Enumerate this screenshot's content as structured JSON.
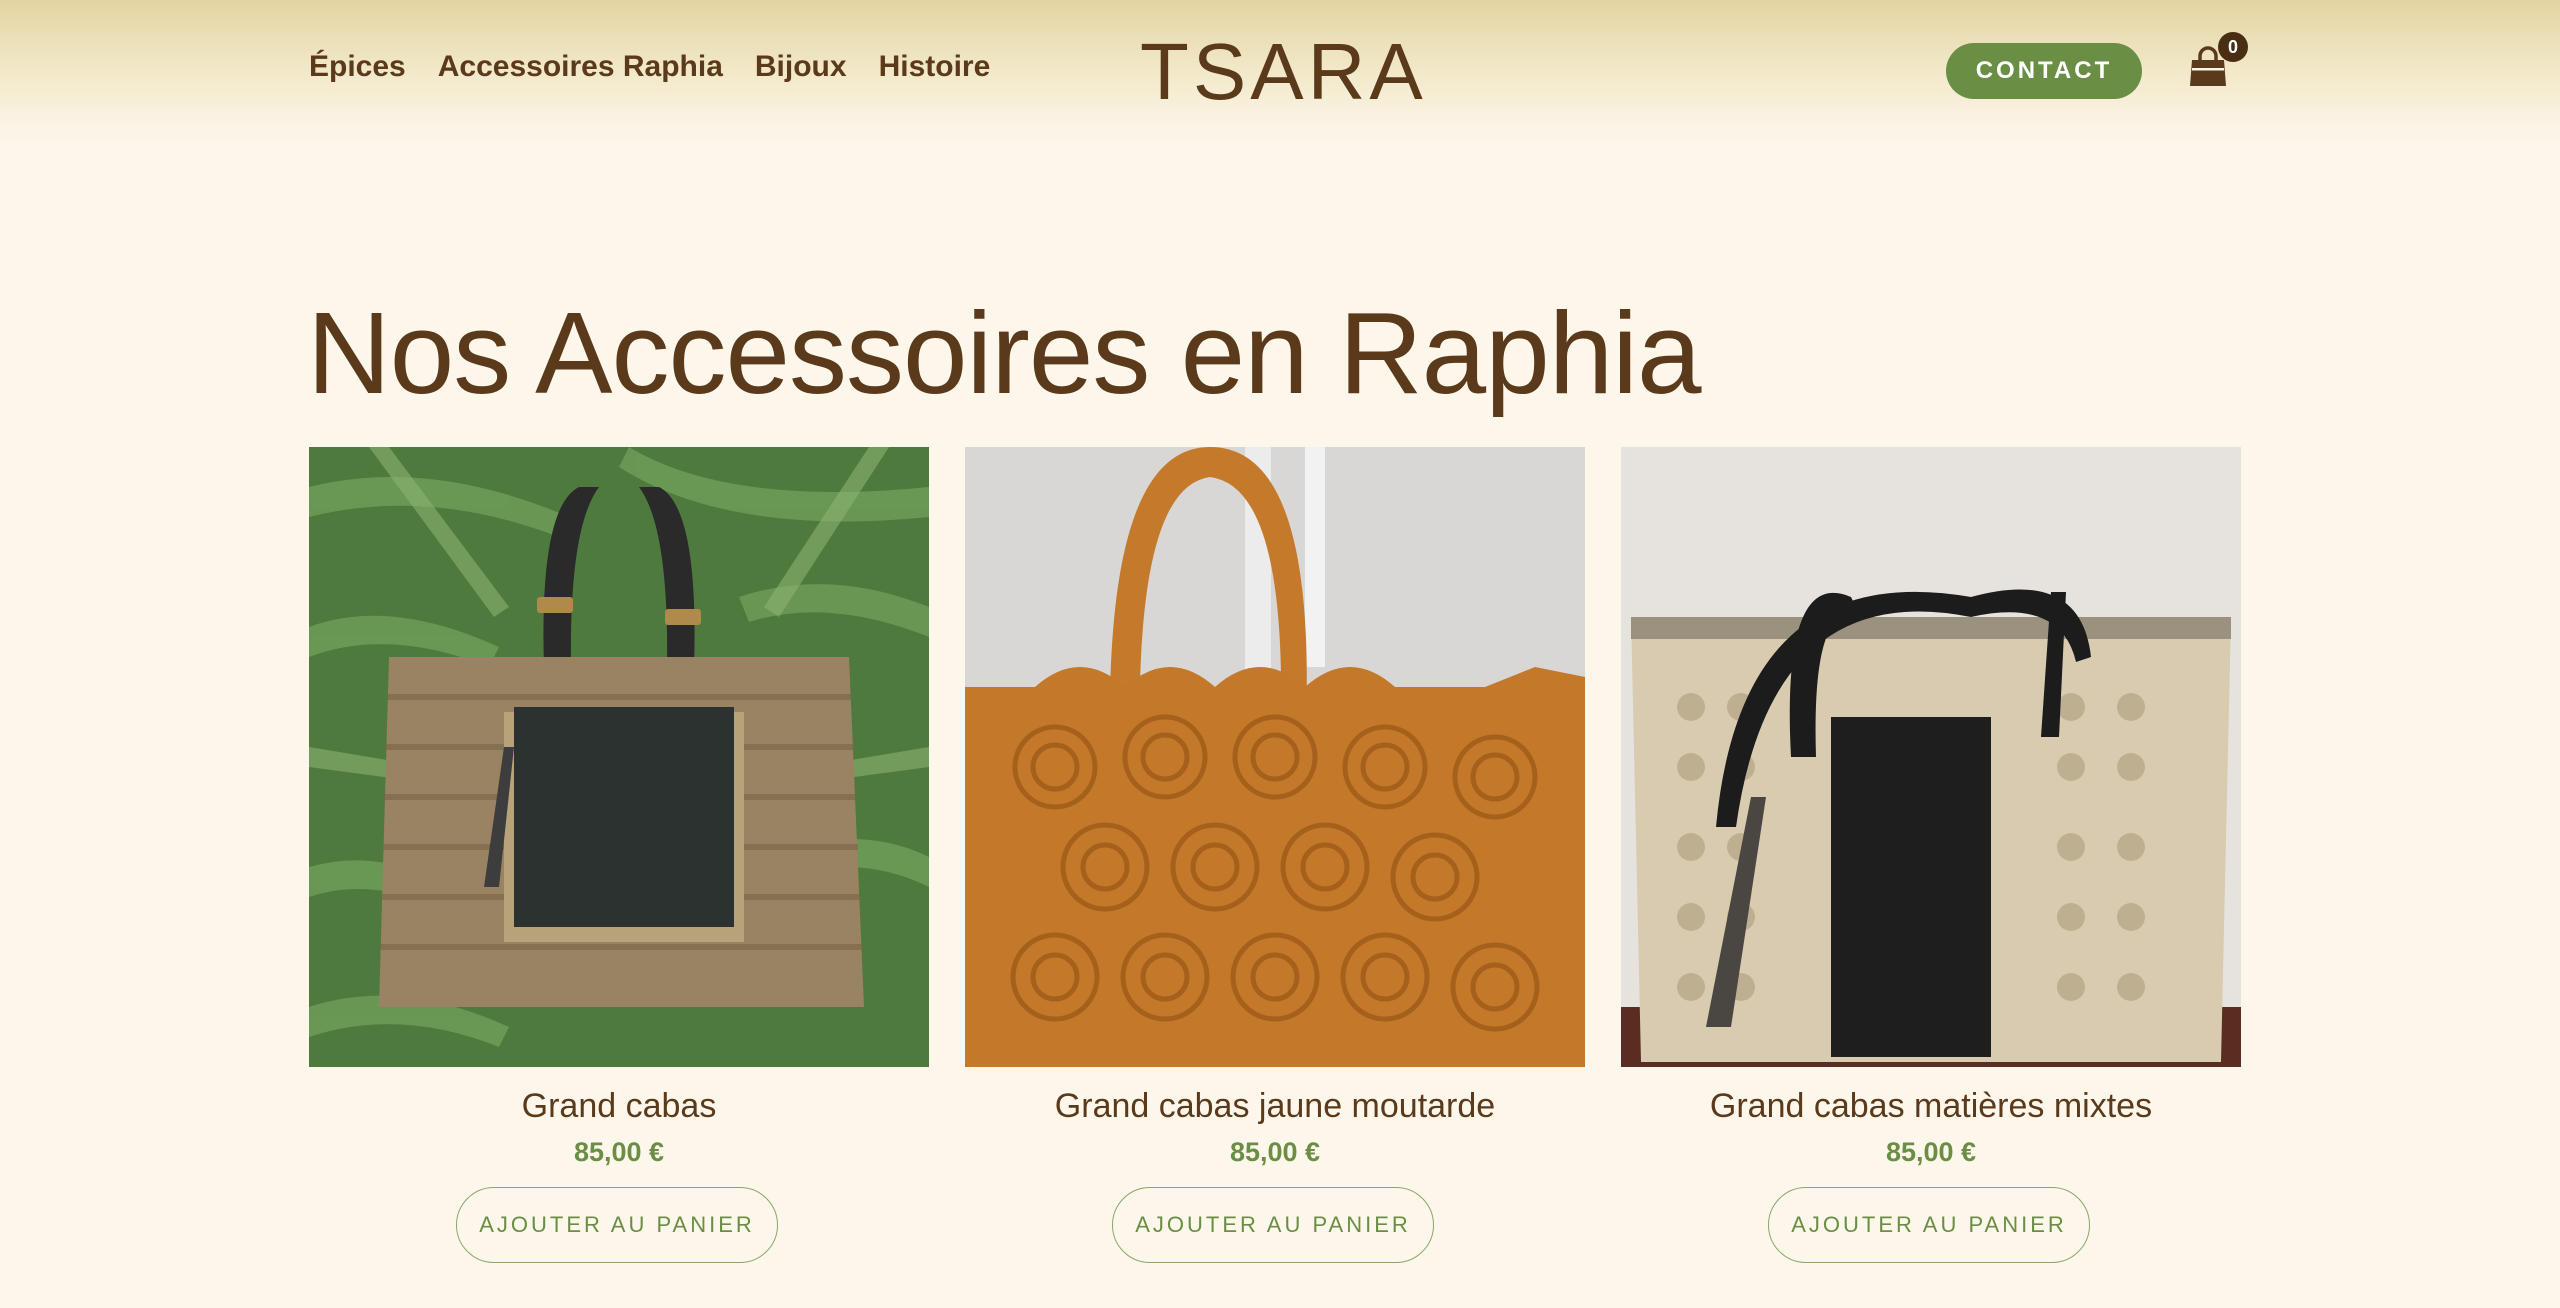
{
  "nav": {
    "items": [
      {
        "label": "Épices"
      },
      {
        "label": "Accessoires Raphia"
      },
      {
        "label": "Bijoux"
      },
      {
        "label": "Histoire"
      }
    ]
  },
  "brand": {
    "logo": "TSARA"
  },
  "header": {
    "contact_label": "CONTACT",
    "cart_count": "0",
    "cart_icon": "shopping-bag-icon"
  },
  "main": {
    "title": "Nos Accessoires en Raphia"
  },
  "products": [
    {
      "name": "Grand cabas",
      "price": "85,00 €",
      "button": "AJOUTER AU PANIER"
    },
    {
      "name": "Grand cabas jaune moutarde",
      "price": "85,00 €",
      "button": "AJOUTER AU PANIER"
    },
    {
      "name": "Grand cabas matières mixtes",
      "price": "85,00 €",
      "button": "AJOUTER AU PANIER"
    }
  ],
  "colors": {
    "background": "#fdf6ea",
    "text": "#5a3a1a",
    "accent": "#6b8e45"
  }
}
